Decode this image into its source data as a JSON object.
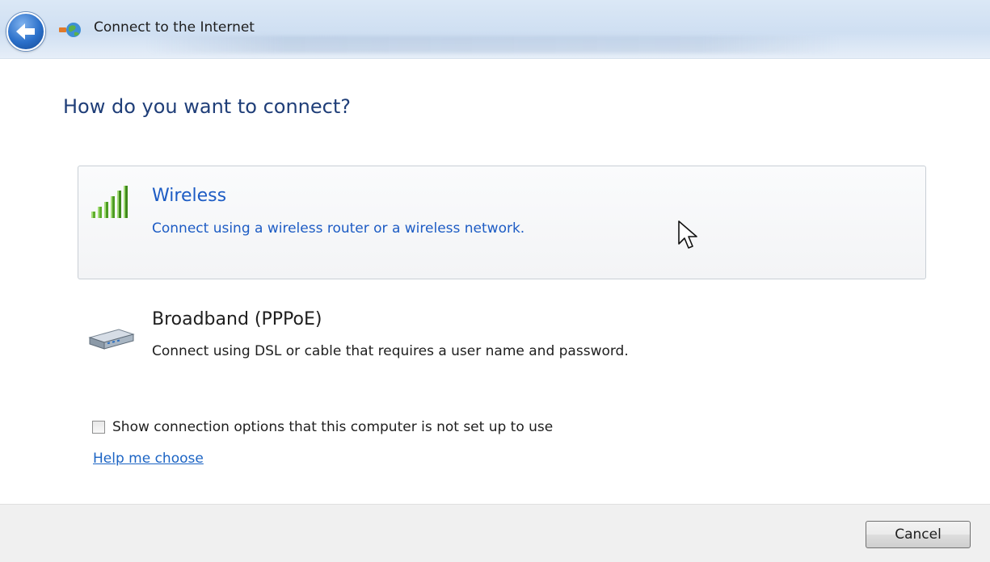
{
  "window": {
    "title": "Connect to the Internet",
    "back_icon": "back-arrow-icon",
    "title_icon": "connect-to-internet-icon"
  },
  "main": {
    "heading": "How do you want to connect?",
    "options": [
      {
        "title": "Wireless",
        "description": "Connect using a wireless router or a wireless network.",
        "icon": "wireless-signal-icon",
        "state": "hover"
      },
      {
        "title": "Broadband (PPPoE)",
        "description": "Connect using DSL or cable that requires a user name and password.",
        "icon": "broadband-modem-icon",
        "state": "normal"
      }
    ],
    "show_options_checkbox": {
      "label": "Show connection options that this computer is not set up to use",
      "checked": false
    },
    "help_link": "Help me choose"
  },
  "footer": {
    "cancel_label": "Cancel"
  },
  "colors": {
    "heading": "#1f3e78",
    "link": "#1c64c4",
    "hover_border": "#c9cfd6",
    "footer_bg": "#f0f0f0"
  }
}
